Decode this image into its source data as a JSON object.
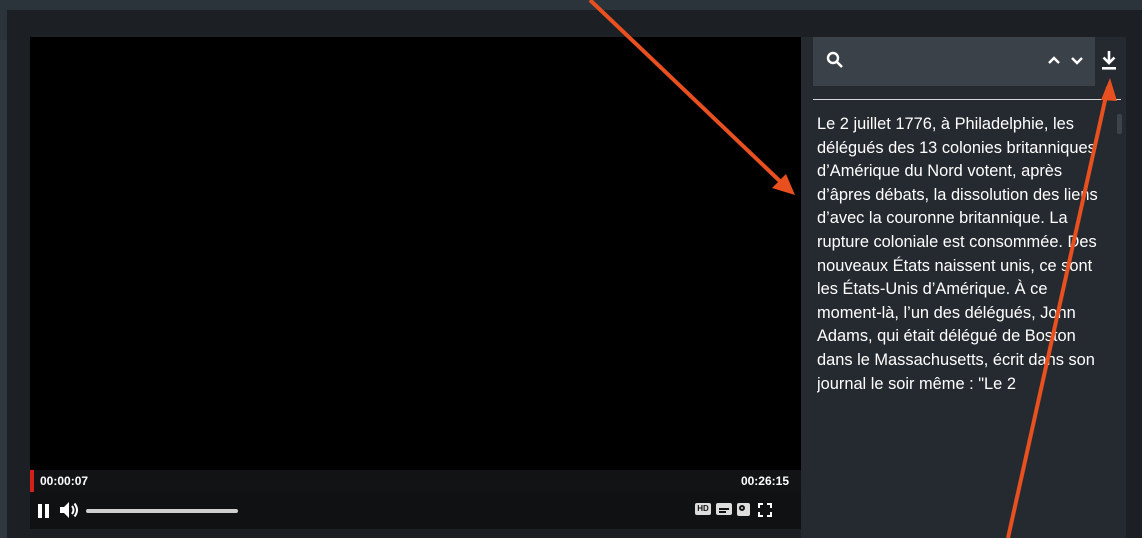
{
  "player": {
    "time_current": "00:00:07",
    "time_total": "00:26:15",
    "progress_fraction": 0.004,
    "volume_level": 1.0,
    "controls": {
      "hd_label": "HD"
    }
  },
  "transcript": {
    "search": {
      "value": "",
      "placeholder": ""
    },
    "text": "Le 2 juillet 1776, à Philadelphie, les délégués des 13 colonies britanniques d’Amérique du Nord votent, après d’âpres débats, la dissolution des liens d’avec la couronne britannique. La rupture coloniale est consommée. Des nouveaux États naissent unis, ce sont les États-Unis d’Amérique. À ce moment-là, l’un des délégués, John Adams, qui était délégué de Boston dans le Massachusetts, écrit dans son journal le soir même : \"Le 2"
  },
  "colors": {
    "progress": "#d3201b",
    "annotation_arrow": "#e8501f",
    "panel_bg": "#252a30",
    "search_bg": "#3b4148"
  },
  "icons": [
    "search-icon",
    "chevron-up-icon",
    "chevron-down-icon",
    "download-icon",
    "pause-icon",
    "volume-icon",
    "hd-icon",
    "subtitles-icon",
    "zoom-icon",
    "fullscreen-icon",
    "annotation-arrow"
  ]
}
